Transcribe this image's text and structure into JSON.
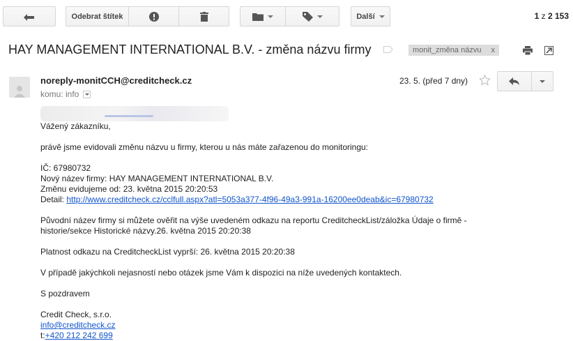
{
  "toolbar": {
    "back_icon": "arrow-left-icon",
    "remove_label": "Odebrat štítek",
    "spam_icon": "report-spam-icon",
    "delete_icon": "trash-icon",
    "move_icon": "folder-icon",
    "labels_icon": "tag-icon",
    "more_label": "Další",
    "pager": {
      "range": "1",
      "separator": "z",
      "total": "2 153"
    }
  },
  "subject": {
    "title": "HAY MANAGEMENT INTERNATIONAL B.V. - změna názvu firmy",
    "label": "monit_změna názvu",
    "label_remove": "x"
  },
  "message": {
    "sender": "noreply-monitCCH@creditcheck.cz",
    "recipients_label": "komu: info",
    "date": "23. 5. (před 7 dny)",
    "greeting": "Vážený zákazníku,",
    "intro": "právě jsme evidovali změnu názvu u firmy, kterou u nás máte zařazenou do monitoringu:",
    "ic_line": "IČ: 67980732",
    "new_name_line": "Nový název firmy: HAY MANAGEMENT INTERNATIONAL B.V.",
    "recorded_line": "Změnu evidujeme od: 23. května 2015 20:20:53",
    "detail_label": "Detail: ",
    "detail_link": "http://www.creditcheck.cz/cclfull.aspx?atl=5053a377-4f96-49a3-991a-16200ee0deab&ic=67980732",
    "verify_line1": "Původní název firmy si můžete ověřit na výše uvedeném odkazu na reportu CreditcheckList/záložka Údaje o firmě -",
    "verify_line2": "historie/sekce Historické názvy.26. května 2015 20:20:38",
    "validity_line": "Platnost odkazu na CreditcheckList vyprší: 26. května 2015 20:20:38",
    "contact_line": "V případě jakýchkoli nejasností nebo otázek jsme Vám k dispozici na níže uvedených kontaktech.",
    "regards": "S pozdravem",
    "company": "Credit Check, s.r.o.",
    "email": "info@creditcheck.cz",
    "phone_prefix": "t:",
    "phone": "+420 212 242 699"
  },
  "colors": {
    "link": "#1155cc",
    "label_chip": "#dddddd"
  }
}
